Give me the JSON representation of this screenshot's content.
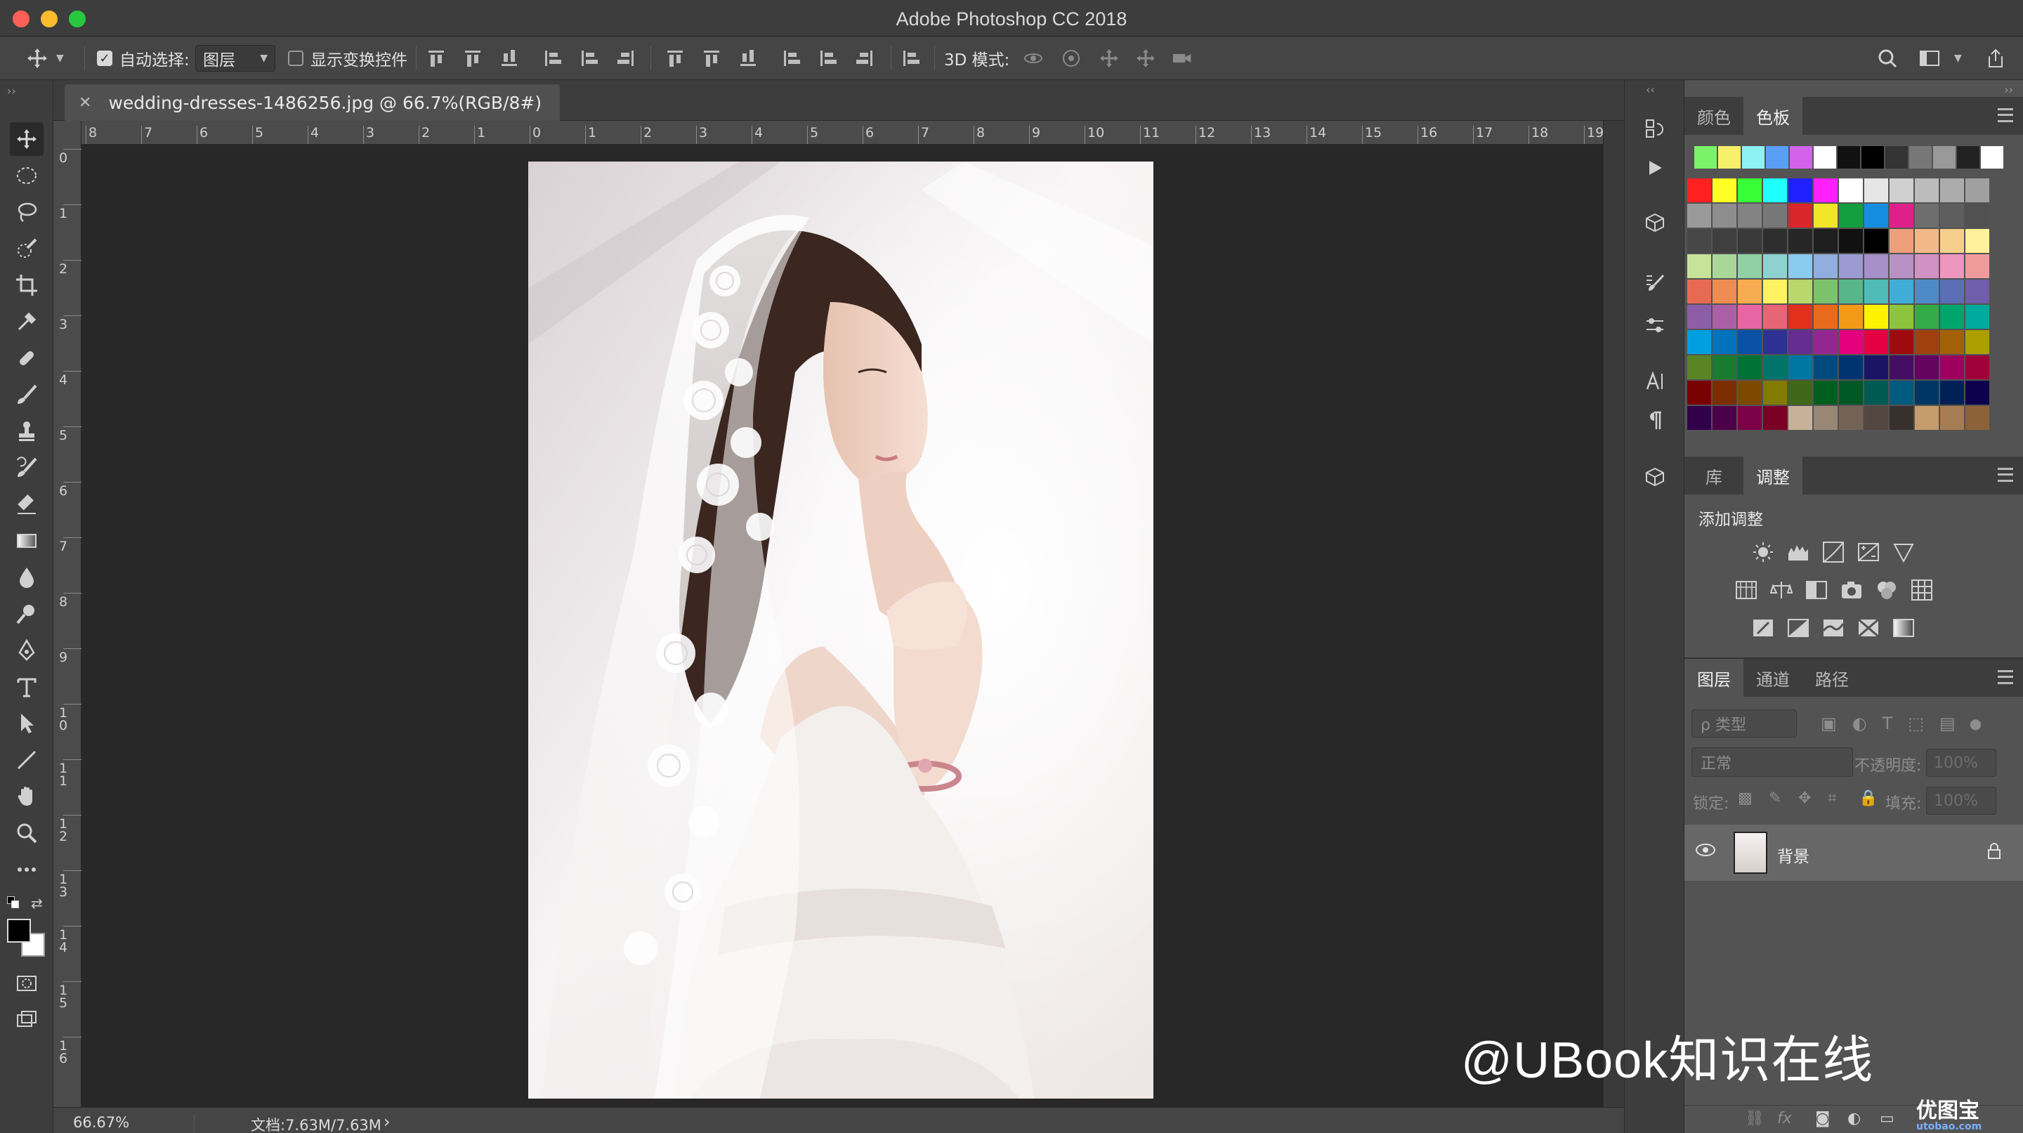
{
  "window": {
    "title": "Adobe Photoshop CC 2018"
  },
  "options_bar": {
    "auto_select_label": "自动选择:",
    "auto_select_checked": true,
    "auto_select_target": "图层",
    "show_transform_label": "显示变换控件",
    "show_transform_checked": false,
    "mode_3d_label": "3D 模式:"
  },
  "document": {
    "tab_title": "wedding-dresses-1486256.jpg @ 66.7%(RGB/8#)",
    "ruler_top": [
      "8",
      "7",
      "6",
      "5",
      "4",
      "3",
      "2",
      "1",
      "0",
      "1",
      "2",
      "3",
      "4",
      "5",
      "6",
      "7",
      "8",
      "9",
      "10",
      "11",
      "12",
      "13",
      "14",
      "15",
      "16",
      "17",
      "18",
      "19"
    ],
    "ruler_left": [
      "0",
      "1",
      "2",
      "3",
      "4",
      "5",
      "6",
      "7",
      "8",
      "9",
      "10",
      "11",
      "12",
      "13",
      "14",
      "15",
      "16"
    ]
  },
  "status_bar": {
    "zoom": "66.67%",
    "doc_info": "文档:7.63M/7.63M",
    "arrow": "›"
  },
  "swatches_panel": {
    "tabs": [
      "颜色",
      "色板"
    ],
    "active_tab": "色板",
    "recent": [
      "#7cf26b",
      "#f7f06a",
      "#8ef1f4",
      "#5a9ef5",
      "#d263e8",
      "#ffffff",
      "#111111",
      "#000000",
      "#333333",
      "#777777",
      "#999999",
      "#222222",
      "#ffffff"
    ],
    "grid": [
      [
        "#ff2020",
        "#ffff26",
        "#39ff39",
        "#20ffff",
        "#2020ff",
        "#ff20ff",
        "#ffffff",
        "#e6e6e6",
        "#d0d0d0",
        "#bcbcbc",
        "#acacac",
        "#a0a0a0"
      ],
      [
        "#9a9a9a",
        "#8e8e8e",
        "#838383",
        "#777777",
        "#d9262a",
        "#f2e62a",
        "#149f3e",
        "#168ee0",
        "#e0208a",
        "#6e6e6e",
        "#5e5e5e",
        "#515151"
      ],
      [
        "#474747",
        "#3f3f3f",
        "#393939",
        "#2e2e2e",
        "#262626",
        "#1e1e1e",
        "#111111",
        "#000000",
        "#ee9f7c",
        "#f2b887",
        "#f7cf8c",
        "#fff29a"
      ],
      [
        "#c7e39a",
        "#a9d79a",
        "#91cfa4",
        "#8dd2cf",
        "#8acbef",
        "#90aede",
        "#9b9ad1",
        "#a690c8",
        "#b892c5",
        "#d092c3",
        "#ed96bf",
        "#f09a9c"
      ],
      [
        "#e86a53",
        "#ee8d52",
        "#f6ad52",
        "#fff263",
        "#b9d76a",
        "#7ac26c",
        "#57b78a",
        "#4fbcb7",
        "#42acd8",
        "#4d8bc7",
        "#5b6eb6",
        "#6f5ea9"
      ],
      [
        "#8c5ea8",
        "#ab60a6",
        "#e765a2",
        "#e86575",
        "#e2301d",
        "#ea6a1d",
        "#f29a16",
        "#fff200",
        "#8dc43e",
        "#33ac48",
        "#00a56b",
        "#00a99d"
      ],
      [
        "#00a0e0",
        "#0073bd",
        "#0a51a3",
        "#2e3192",
        "#652d91",
        "#92278f",
        "#e4007f",
        "#e50044",
        "#9e0b0f",
        "#a0410d",
        "#a36209",
        "#aba000"
      ],
      [
        "#598527",
        "#197b30",
        "#007236",
        "#00746b",
        "#0076a3",
        "#004a80",
        "#003471",
        "#1b1464",
        "#440e62",
        "#630460",
        "#9e005d",
        "#9e0039"
      ],
      [
        "#790000",
        "#7b2e00",
        "#7d4900",
        "#827b00",
        "#406618",
        "#005e20",
        "#005826",
        "#005952",
        "#005b7f",
        "#003663",
        "#002157",
        "#0d004c"
      ],
      [
        "#32004b",
        "#4b0049",
        "#7b0046",
        "#7a0026",
        "#c7b299",
        "#998675",
        "#736357",
        "#534741",
        "#37302d",
        "#c69c6d",
        "#a67c52",
        "#8c6239"
      ]
    ]
  },
  "adjustments_panel": {
    "tabs": [
      "库",
      "调整"
    ],
    "active_tab": "调整",
    "label": "添加调整"
  },
  "layers_panel": {
    "tabs": [
      "图层",
      "通道",
      "路径"
    ],
    "active_tab": "图层",
    "filter_placeholder": "ρ 类型",
    "blend_mode": "正常",
    "opacity_label": "不透明度:",
    "opacity_value": "100%",
    "lock_label": "锁定:",
    "fill_label": "填充:",
    "fill_value": "100%",
    "layers": [
      {
        "name": "背景",
        "visible": true,
        "locked": true
      }
    ]
  },
  "watermark": {
    "text": "@UBook知识在线",
    "logo_text": "优图宝",
    "logo_sub": "utobao.com"
  }
}
